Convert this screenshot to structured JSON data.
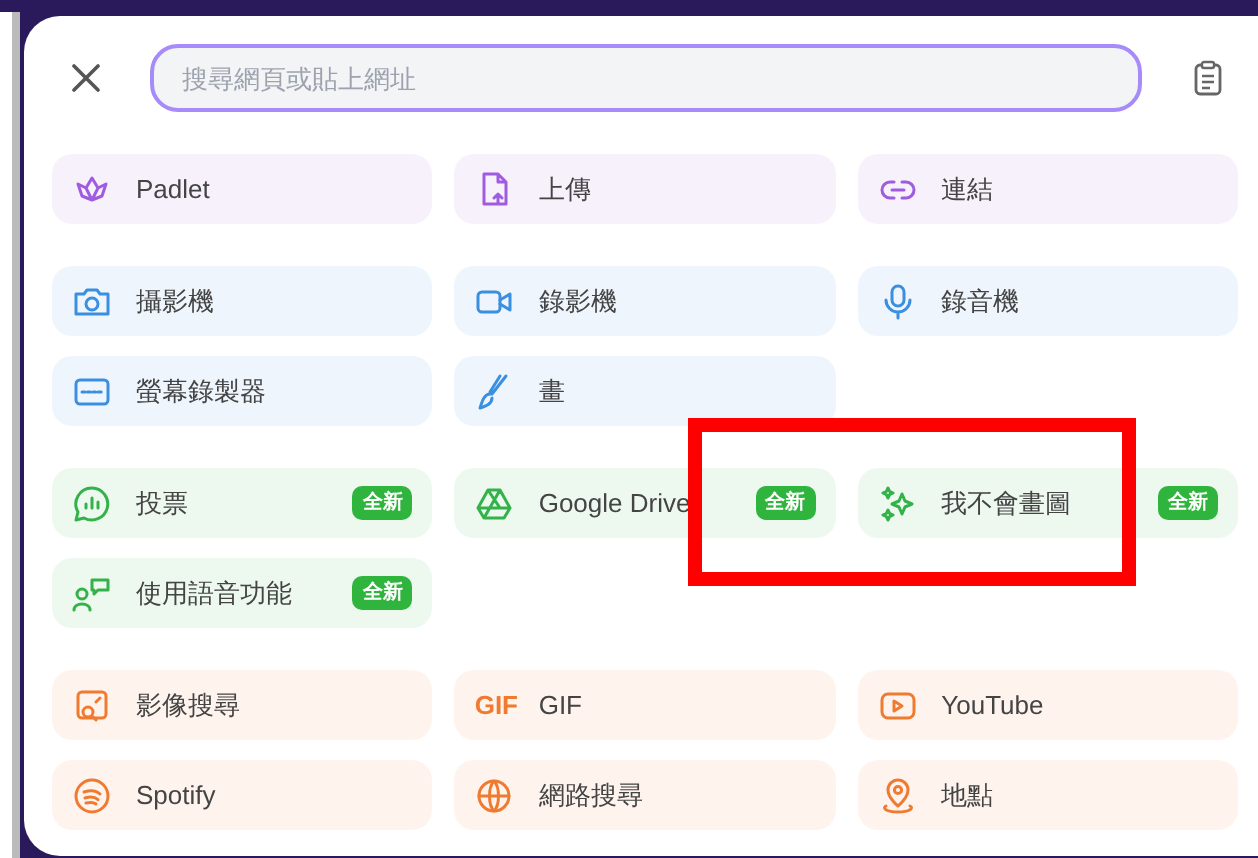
{
  "search": {
    "placeholder": "搜尋網頁或貼上網址"
  },
  "sections": [
    {
      "color": "#a05ce0",
      "items": [
        {
          "label": "Padlet"
        },
        {
          "label": "上傳"
        },
        {
          "label": "連結"
        }
      ]
    },
    {
      "color": "#3b8fe0",
      "items": [
        {
          "label": "攝影機"
        },
        {
          "label": "錄影機"
        },
        {
          "label": "錄音機"
        },
        {
          "label": "螢幕錄製器"
        },
        {
          "label": "畫"
        }
      ]
    },
    {
      "color": "#34b24a",
      "items": [
        {
          "label": "投票",
          "badge": "全新"
        },
        {
          "label": "Google Drive",
          "badge": "全新"
        },
        {
          "label": "我不會畫圖",
          "badge": "全新"
        },
        {
          "label": "使用語音功能",
          "badge": "全新"
        }
      ]
    },
    {
      "color": "#f07a30",
      "items": [
        {
          "label": "影像搜尋"
        },
        {
          "label": "GIF",
          "icon_text": "GIF"
        },
        {
          "label": "YouTube"
        },
        {
          "label": "Spotify"
        },
        {
          "label": "網路搜尋"
        },
        {
          "label": "地點"
        }
      ]
    }
  ],
  "annotation": {
    "kind": "rectangle"
  }
}
